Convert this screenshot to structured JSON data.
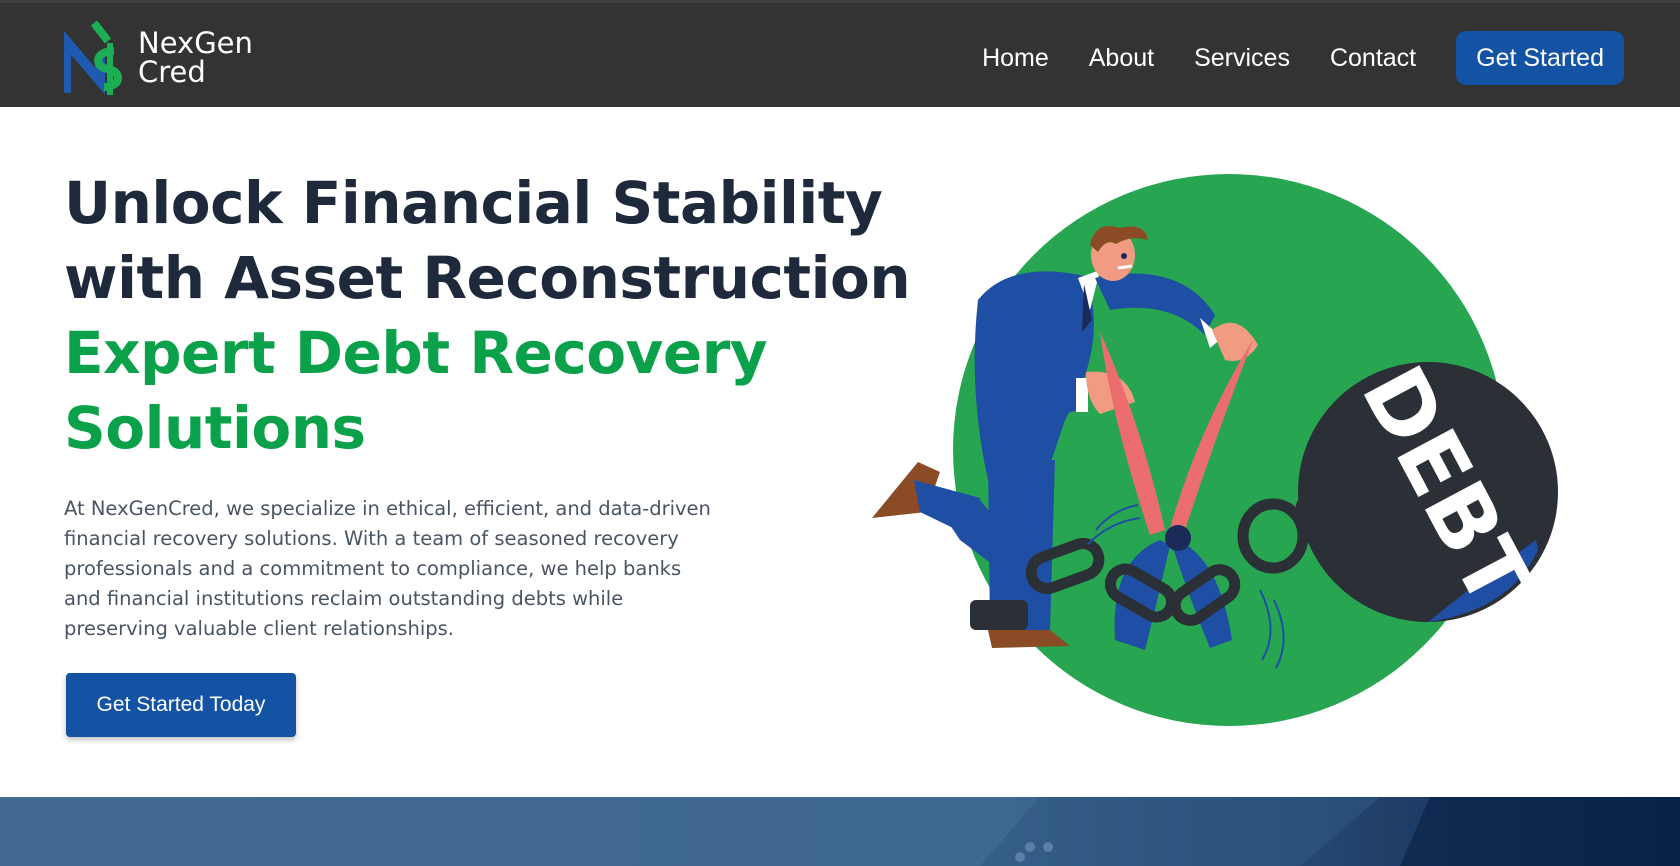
{
  "header": {
    "logo": {
      "line1": "NexGen",
      "line2": "Cred"
    },
    "nav": [
      {
        "label": "Home"
      },
      {
        "label": "About"
      },
      {
        "label": "Services"
      },
      {
        "label": "Contact"
      }
    ],
    "cta_label": "Get Started"
  },
  "hero": {
    "title_line1": "Unlock Financial Stability",
    "title_line2": "with Asset Reconstruction",
    "highlight_line1": "Expert Debt Recovery",
    "highlight_line2": "Solutions",
    "description": "At NexGenCred, we specialize in ethical, efficient, and data-driven financial recovery solutions. With a team of seasoned recovery professionals and a commitment to compliance, we help banks and financial institutions reclaim outstanding debts while preserving valuable client relationships.",
    "button_label": "Get Started Today",
    "illustration": {
      "ball_text": "DEBT"
    }
  },
  "colors": {
    "header_bg": "#333333",
    "brand_blue": "#1452a3",
    "brand_green": "#0aa14a",
    "title_dark": "#1e2a3b",
    "circle_green": "#27a550"
  }
}
